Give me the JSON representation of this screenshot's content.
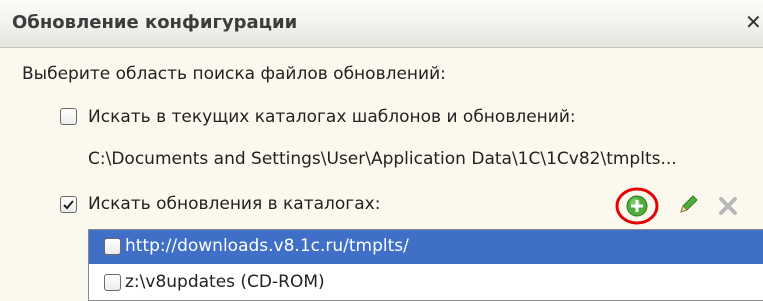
{
  "dialog": {
    "title": "Обновление конфигурации",
    "close_glyph": "✕"
  },
  "prompt": "Выберите область поиска файлов обновлений:",
  "option_templates": {
    "label": "Искать в текущих каталогах шаблонов и обновлений:",
    "checked": false,
    "path": "C:\\Documents and Settings\\User\\Application Data\\1C\\1Cv82\\tmplts..."
  },
  "option_catalogs": {
    "label": "Искать обновления в каталогах:",
    "checked": true
  },
  "toolbar": {
    "add_icon": "add-circle-icon",
    "edit_icon": "pencil-icon",
    "delete_icon": "delete-x-icon",
    "highlight_color": "#e60000"
  },
  "catalogs": [
    {
      "path": "http://downloads.v8.1c.ru/tmplts/",
      "checked": false,
      "selected": true
    },
    {
      "path": "z:\\v8updates (CD-ROM)",
      "checked": false,
      "selected": false
    }
  ],
  "colors": {
    "background": "#fbf9ed",
    "selection": "#3f6fc7",
    "add_green": "#4fae3a"
  }
}
